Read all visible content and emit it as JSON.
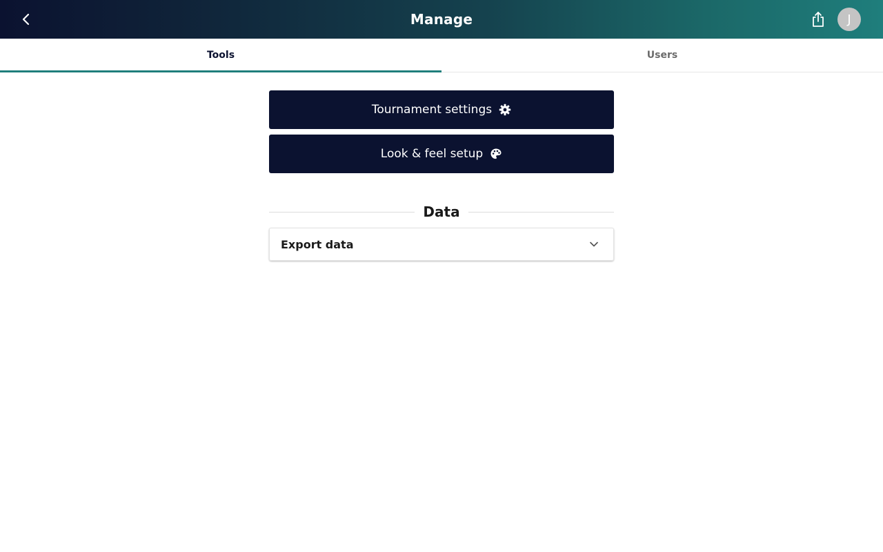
{
  "header": {
    "title": "Manage",
    "avatar_initial": "J"
  },
  "tabs": [
    {
      "label": "Tools",
      "active": true
    },
    {
      "label": "Users",
      "active": false
    }
  ],
  "tools": {
    "buttons": [
      {
        "label": "Tournament settings",
        "icon": "gear-icon"
      },
      {
        "label": "Look & feel setup",
        "icon": "palette-icon"
      }
    ],
    "data_section": {
      "title": "Data",
      "accordion": {
        "title": "Export data",
        "expanded": false
      }
    }
  },
  "colors": {
    "header_start": "#0b1230",
    "header_end": "#1f7e7c",
    "button_bg": "#0b1230",
    "tab_indicator": "#1f7e7c"
  }
}
